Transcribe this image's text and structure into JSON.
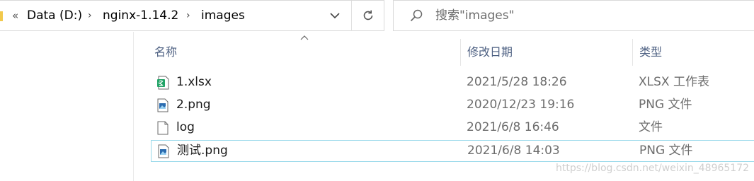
{
  "address_bar": {
    "overflow": "«",
    "breadcrumbs": [
      "Data (D:)",
      "nginx-1.14.2",
      "images"
    ],
    "separator": "›"
  },
  "search": {
    "placeholder": "搜索\"images\""
  },
  "columns": {
    "name": "名称",
    "date": "修改日期",
    "type": "类型"
  },
  "files": [
    {
      "name": "1.xlsx",
      "date": "2021/5/28 18:26",
      "type": "XLSX 工作表",
      "icon": "excel-file-icon"
    },
    {
      "name": "2.png",
      "date": "2020/12/23 19:16",
      "type": "PNG 文件",
      "icon": "image-file-icon"
    },
    {
      "name": "log",
      "date": "2021/6/8 16:46",
      "type": "文件",
      "icon": "blank-file-icon"
    },
    {
      "name": "测试.png",
      "date": "2021/6/8 14:03",
      "type": "PNG 文件",
      "icon": "image-file-icon"
    }
  ],
  "watermark": "https://blog.csdn.net/weixin_48965172",
  "colors": {
    "accent": "#99d9ea",
    "header_text": "#4d6082",
    "excel_green": "#21a366"
  }
}
